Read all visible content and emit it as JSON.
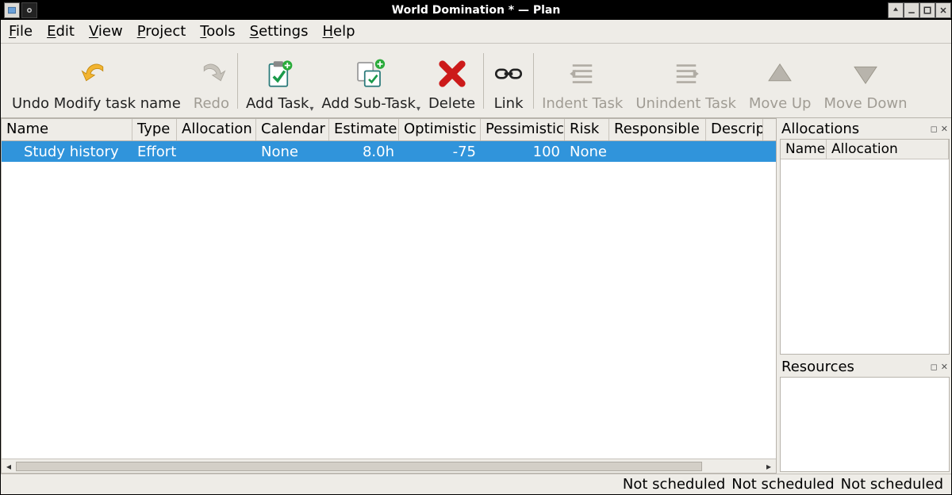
{
  "title": "World Domination * — Plan",
  "menu": {
    "file": "File",
    "edit": "Edit",
    "view": "View",
    "project": "Project",
    "tools": "Tools",
    "settings": "Settings",
    "help": "Help"
  },
  "toolbar": {
    "undo": "Undo Modify task name",
    "redo": "Redo",
    "add_task": "Add Task",
    "add_subtask": "Add Sub-Task",
    "delete": "Delete",
    "link": "Link",
    "indent": "Indent Task",
    "unindent": "Unindent Task",
    "move_up": "Move Up",
    "move_down": "Move Down"
  },
  "columns": {
    "name": "Name",
    "type": "Type",
    "allocation": "Allocation",
    "calendar": "Calendar",
    "estimate": "Estimate",
    "optimistic": "Optimistic",
    "pessimistic": "Pessimistic",
    "risk": "Risk",
    "responsible": "Responsible",
    "description": "Descrip"
  },
  "rows": [
    {
      "name": "Study history",
      "type": "Effort",
      "allocation": "",
      "calendar": "None",
      "estimate": "8.0h",
      "optimistic": "-75",
      "pessimistic": "100",
      "risk": "None",
      "responsible": "",
      "description": ""
    }
  ],
  "side": {
    "allocations_title": "Allocations",
    "alloc_cols": {
      "name": "Name",
      "allocation": "Allocation"
    },
    "resources_title": "Resources"
  },
  "status": {
    "a": "Not scheduled",
    "b": "Not scheduled",
    "c": "Not scheduled"
  }
}
